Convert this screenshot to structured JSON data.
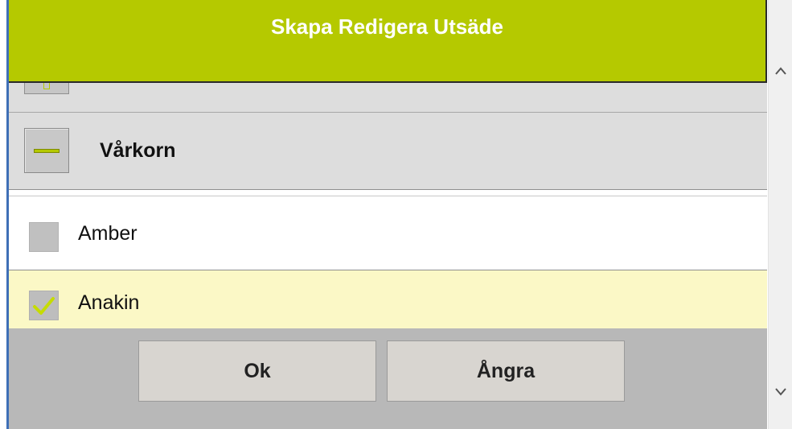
{
  "dialog": {
    "title": "Skapa Redigera Utsäde",
    "accent_color": "#b5c900"
  },
  "group": {
    "label": "Vårkorn",
    "expanded": true,
    "toggle_icon": "minus-icon"
  },
  "items": [
    {
      "label": "Amber",
      "checked": false
    },
    {
      "label": "Anakin",
      "checked": true
    }
  ],
  "buttons": {
    "ok_label": "Ok",
    "cancel_label": "Ångra"
  },
  "scrollbar": {
    "up_icon": "chevron-up-icon",
    "down_icon": "chevron-down-icon"
  }
}
